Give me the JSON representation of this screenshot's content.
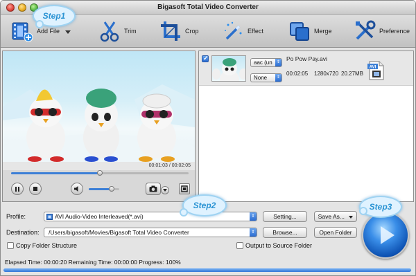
{
  "window": {
    "title": "Bigasoft Total Video Converter"
  },
  "toolbar": {
    "add_file": "Add File",
    "trim": "Trim",
    "crop": "Crop",
    "effect": "Effect",
    "merge": "Merge",
    "preference": "Preference"
  },
  "callouts": {
    "step1": "Step1",
    "step2": "Step2",
    "step3": "Step3"
  },
  "player": {
    "time_display": "00:01:03 / 00:02:05",
    "seek_progress": 0.5,
    "volume_level": 0.75,
    "controls": [
      "pause-icon",
      "stop-icon",
      "volume-icon",
      "camera-icon",
      "dropdown-icon",
      "fullscreen-icon"
    ]
  },
  "file": {
    "name": "Po Pow Pay.avi",
    "duration": "00:02:05",
    "resolution": "1280x720",
    "size": "20.27MB",
    "audio_track": "aac (un",
    "subtitle": "None",
    "format_badge": "AVI",
    "checked": true
  },
  "bottom": {
    "profile_label": "Profile:",
    "profile_value": "AVI Audio-Video Interleaved(*.avi)",
    "setting_button": "Setting...",
    "save_as_button": "Save As...",
    "destination_label": "Destination:",
    "destination_value": "/Users/bigasoft/Movies/Bigasoft Total Video Converter",
    "browse_button": "Browse...",
    "open_folder_button": "Open Folder",
    "copy_folder_structure": "Copy Folder Structure",
    "output_to_source_folder": "Output to Source Folder"
  },
  "status": {
    "text": "Elapsed Time: 00:00:20 Remaining Time: 00:00:00 Progress: 100%",
    "progress": 1.0
  },
  "colors": {
    "accent": "#2c6dd1",
    "callout": "#2a93d3"
  }
}
